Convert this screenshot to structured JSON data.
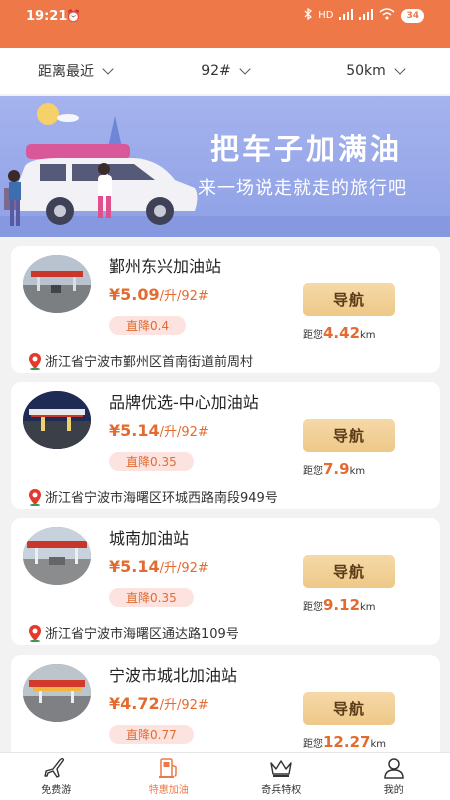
{
  "status": {
    "time": "19:21",
    "battery": "34",
    "network": "HD"
  },
  "filters": [
    {
      "label": "距离最近"
    },
    {
      "label": "92#"
    },
    {
      "label": "50km"
    }
  ],
  "banner": {
    "title": "把车子加满油",
    "subtitle": "来一场说走就走的旅行吧"
  },
  "stations": [
    {
      "name": "鄞州东兴加油站",
      "price": "¥5.09",
      "unit": "/升/92#",
      "drop": "直降0.4",
      "nav": "导航",
      "dist_prefix": "距您",
      "dist": "4.42",
      "dist_unit": "km",
      "address": "浙江省宁波市鄞州区首南街道前周村"
    },
    {
      "name": "品牌优选-中心加油站",
      "price": "¥5.14",
      "unit": "/升/92#",
      "drop": "直降0.35",
      "nav": "导航",
      "dist_prefix": "距您",
      "dist": "7.9",
      "dist_unit": "km",
      "address": "浙江省宁波市海曙区环城西路南段949号"
    },
    {
      "name": "城南加油站",
      "price": "¥5.14",
      "unit": "/升/92#",
      "drop": "直降0.35",
      "nav": "导航",
      "dist_prefix": "距您",
      "dist": "9.12",
      "dist_unit": "km",
      "address": "浙江省宁波市海曙区通达路109号"
    },
    {
      "name": "宁波市城北加油站",
      "price": "¥4.72",
      "unit": "/升/92#",
      "drop": "直降0.77",
      "nav": "导航",
      "dist_prefix": "距您",
      "dist": "12.27",
      "dist_unit": "km",
      "address": ""
    }
  ],
  "tabs": [
    {
      "label": "免费游",
      "icon": "plane-icon"
    },
    {
      "label": "特惠加油",
      "icon": "fuel-pump-icon"
    },
    {
      "label": "奇兵特权",
      "icon": "crown-icon"
    },
    {
      "label": "我的",
      "icon": "user-icon"
    }
  ],
  "colors": {
    "accent": "#ee7847",
    "price": "#e36b2f",
    "banner": "#a5b3ee",
    "button": "#f0cf95"
  }
}
